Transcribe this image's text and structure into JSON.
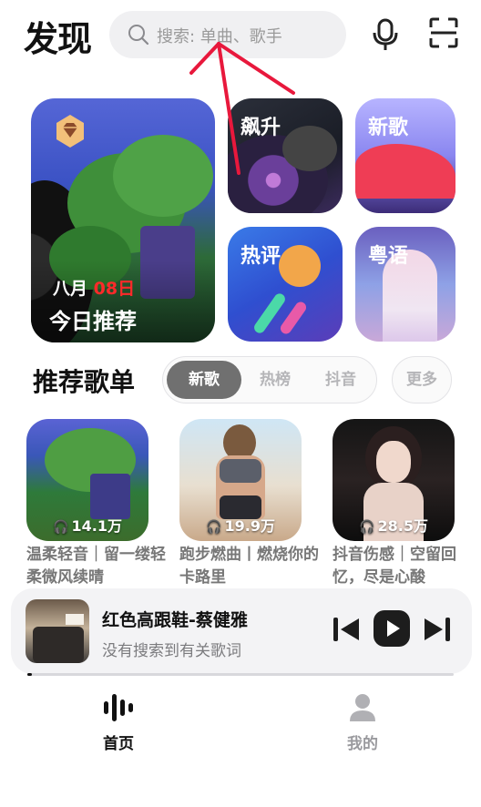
{
  "header": {
    "title": "发现",
    "search_placeholder": "搜索: 单曲、歌手",
    "icons": [
      "search-icon",
      "microphone-icon",
      "scan-icon"
    ]
  },
  "banner": {
    "main": {
      "month": "八月",
      "day": "08日",
      "title": "今日推荐",
      "badge_icon": "diamond-icon"
    },
    "tiles": [
      {
        "label": "飙升"
      },
      {
        "label": "新歌"
      },
      {
        "label": "热评"
      },
      {
        "label": "粤语"
      }
    ]
  },
  "playlists_section": {
    "title": "推荐歌单",
    "tabs": [
      {
        "label": "新歌",
        "active": true
      },
      {
        "label": "热榜",
        "active": false
      },
      {
        "label": "抖音",
        "active": false
      }
    ],
    "more_label": "更多",
    "items": [
      {
        "play_count": "14.1万",
        "title": "温柔轻音｜留一缕轻柔微风续晴"
      },
      {
        "play_count": "19.9万",
        "title": "跑步燃曲丨燃烧你的卡路里"
      },
      {
        "play_count": "28.5万",
        "title": "抖音伤感｜空留回忆，尽是心酸"
      }
    ]
  },
  "player": {
    "song": "红色高跟鞋-蔡健雅",
    "lyric_status": "没有搜索到有关歌词",
    "progress": 0.01,
    "controls": [
      "previous-icon",
      "play-icon",
      "next-icon"
    ]
  },
  "nav": {
    "items": [
      {
        "label": "首页",
        "icon": "waveform-icon",
        "active": true
      },
      {
        "label": "我的",
        "icon": "person-icon",
        "active": false
      }
    ]
  },
  "colors": {
    "accent_red": "#ff2a2a",
    "annotation_red": "#e8183c",
    "active_tab": "#707070"
  }
}
